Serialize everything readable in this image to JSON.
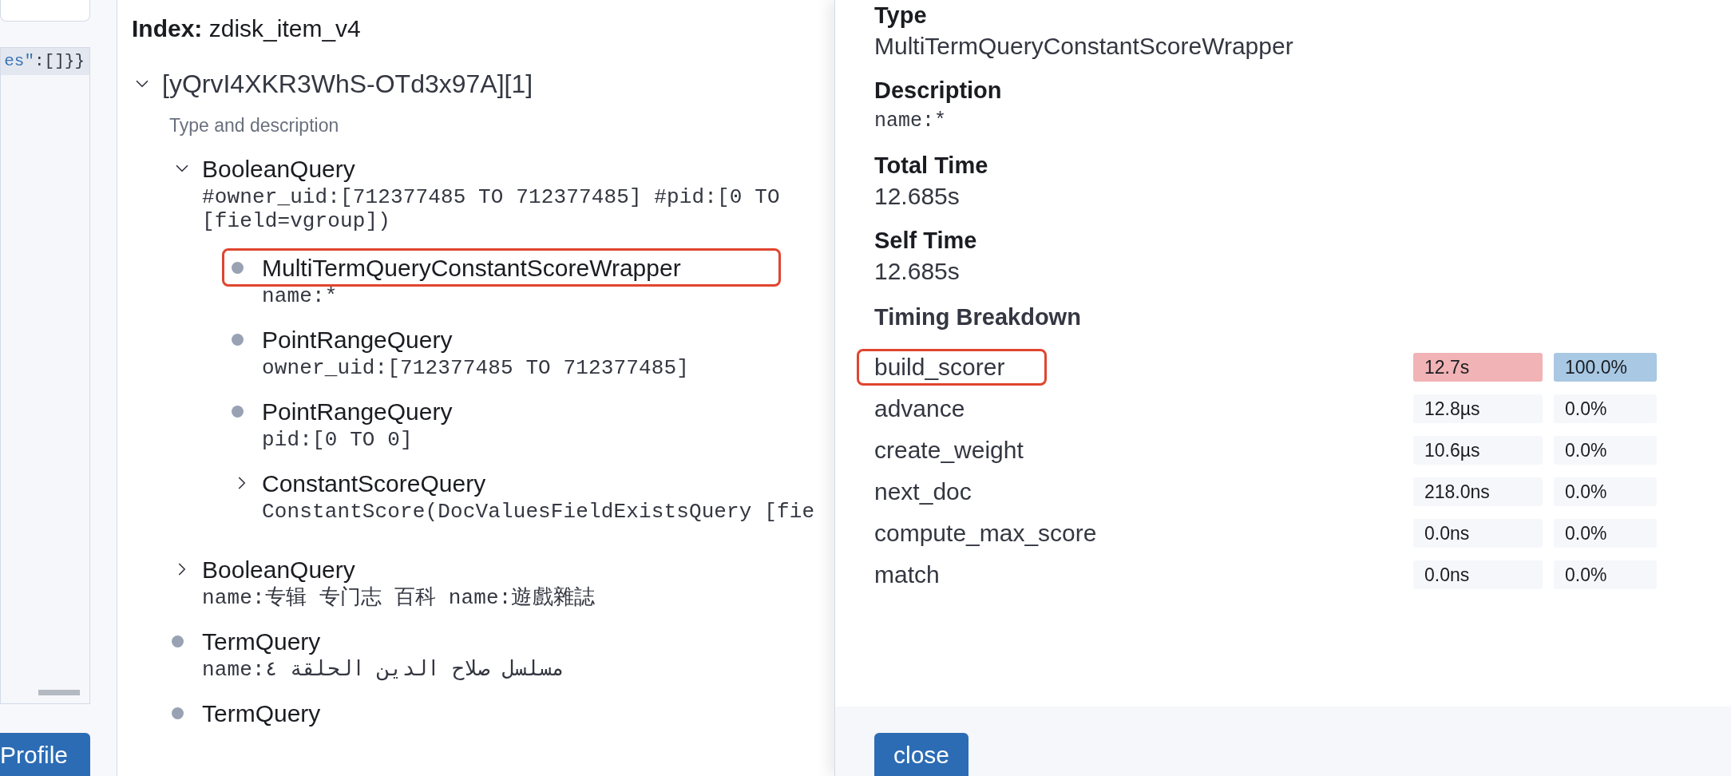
{
  "sidebar": {
    "editor_tokens": [
      {
        "text": "es\"",
        "kind": "string"
      },
      {
        "text": ":[]}}",
        "kind": "punct"
      }
    ],
    "profile_button": "Profile"
  },
  "profile": {
    "index_title": "**Index:** zdisk_item_v4",
    "shard": {
      "label": "[yQrvI4XKR3WhS-OTd3x97A][1]",
      "expanded": true,
      "section_title": "Type and description",
      "queries": [
        {
          "kind": "branch",
          "expanded": true,
          "annotated": false,
          "label": "BooleanQuery",
          "description": [
            "#owner_uid:[712377485 TO 712377485] #pid:[0 TO",
            "[field=vgroup])"
          ],
          "children": [
            {
              "kind": "leaf",
              "annotated": true,
              "label": "MultiTermQueryConstantScoreWrapper",
              "description": [
                "name:*"
              ]
            },
            {
              "kind": "leaf",
              "annotated": false,
              "label": "PointRangeQuery",
              "description": [
                "owner_uid:[712377485 TO 712377485]"
              ]
            },
            {
              "kind": "leaf",
              "annotated": false,
              "label": "PointRangeQuery",
              "description": [
                "pid:[0 TO 0]"
              ]
            },
            {
              "kind": "branch",
              "expanded": false,
              "annotated": false,
              "label": "ConstantScoreQuery",
              "description": [
                "ConstantScore(DocValuesFieldExistsQuery [fie"
              ]
            }
          ]
        },
        {
          "kind": "branch",
          "expanded": false,
          "annotated": false,
          "label": "BooleanQuery",
          "description": [
            "name:专辑 专门志 百科 name:遊戲雜誌"
          ]
        },
        {
          "kind": "leaf",
          "annotated": false,
          "label": "TermQuery",
          "description": [
            "name:مسلسل صلاح الدين الحلقة ٤"
          ]
        },
        {
          "kind": "leaf",
          "annotated": false,
          "label": "TermQuery"
        }
      ]
    }
  },
  "details": {
    "fields": [
      {
        "label": "Type",
        "value": "MultiTermQueryConstantScoreWrapper",
        "kind": "text"
      },
      {
        "label": "Description",
        "value": "name:*",
        "kind": "code"
      },
      {
        "label": "Total Time",
        "value": "12.685s",
        "kind": "text"
      },
      {
        "label": "Self Time",
        "value": "12.685s",
        "kind": "text"
      }
    ],
    "breakdown_title": "Timing Breakdown",
    "rows": [
      {
        "name": "build_scorer",
        "annotated": true,
        "time": "12.7s",
        "percent": "100.0%",
        "level": 1
      },
      {
        "name": "advance",
        "annotated": false,
        "time": "12.8µs",
        "percent": "0.0%",
        "level": 0
      },
      {
        "name": "create_weight",
        "annotated": false,
        "time": "10.6µs",
        "percent": "0.0%",
        "level": 0
      },
      {
        "name": "next_doc",
        "annotated": false,
        "time": "218.0ns",
        "percent": "0.0%",
        "level": 0
      },
      {
        "name": "compute_max_score",
        "annotated": false,
        "time": "0.0ns",
        "percent": "0.0%",
        "level": 0
      },
      {
        "name": "match",
        "annotated": false,
        "time": "0.0ns",
        "percent": "0.0%",
        "level": 0
      }
    ],
    "close_button": "close"
  }
}
